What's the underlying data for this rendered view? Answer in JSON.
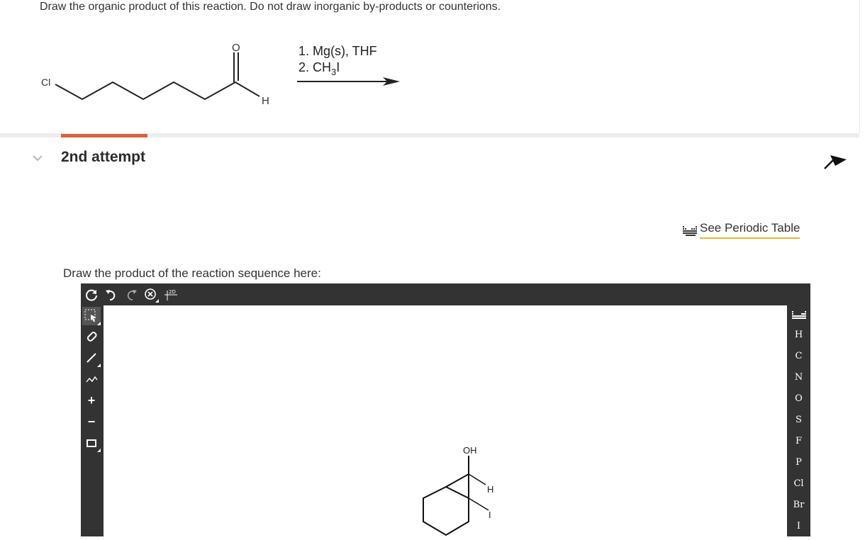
{
  "question": {
    "text": "Draw the organic product of this reaction. Do not draw inorganic by-products or counterions.",
    "reactant_labels": {
      "cl": "Cl",
      "o": "O",
      "h": "H"
    },
    "conditions": {
      "step1": "1. Mg(s), THF",
      "step2_prefix": "2. CH",
      "step2_sub": "3",
      "step2_suffix": "I"
    }
  },
  "attempt": {
    "title": "2nd attempt"
  },
  "periodic": {
    "label": "See Periodic Table"
  },
  "prompt": "Draw the product of the reaction sequence here:",
  "editor": {
    "top_tools": [
      "refresh-icon",
      "undo-icon",
      "redo-icon",
      "zoom-reset-icon",
      "2d-clean-icon"
    ],
    "clean_label": "2D",
    "left_tools": [
      "select-icon",
      "eraser-icon",
      "bond-icon",
      "chain-icon",
      "plus-charge-icon",
      "minus-charge-icon",
      "template-icon"
    ],
    "plus": "+",
    "minus": "−",
    "atoms": [
      "H",
      "C",
      "N",
      "O",
      "S",
      "F",
      "P",
      "Cl",
      "Br",
      "I"
    ],
    "canvas_labels": {
      "oh": "OH",
      "h": "H",
      "i": "I"
    }
  },
  "colors": {
    "accent": "#d9623f",
    "underline": "#e9b43a",
    "editor_bg": "#333333"
  }
}
